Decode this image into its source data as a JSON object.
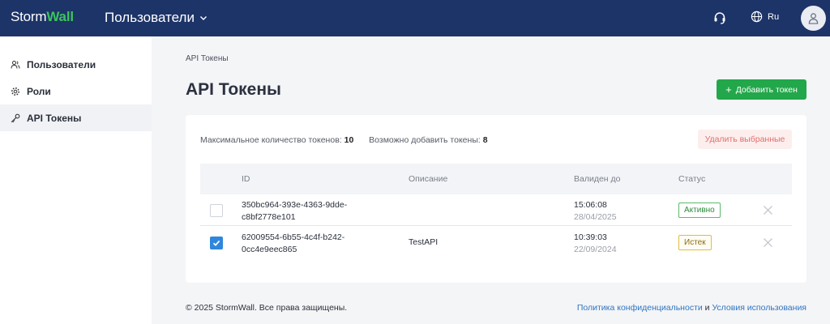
{
  "header": {
    "logo_storm": "Storm",
    "logo_wall": "Wall",
    "section_title": "Пользователи",
    "lang": "Ru",
    "icons": {
      "support": "headset-icon",
      "lang": "globe-icon",
      "avatar": "user-icon"
    }
  },
  "sidebar": {
    "items": [
      {
        "label": "Пользователи",
        "icon": "users-icon",
        "active": false
      },
      {
        "label": "Роли",
        "icon": "gear-icon",
        "active": false
      },
      {
        "label": "API Токены",
        "icon": "key-icon",
        "active": true
      }
    ]
  },
  "main": {
    "breadcrumb": "API Токены",
    "title": "API Токены",
    "add_button": "Добавить токен",
    "stats": {
      "max_label": "Максимальное количество токенов:",
      "max_value": "10",
      "avail_label": "Возможно добавить токены:",
      "avail_value": "8"
    },
    "delete_button": "Удалить выбранные",
    "table": {
      "headers": {
        "id": "ID",
        "desc": "Описание",
        "valid": "Валиден до",
        "status": "Статус"
      },
      "rows": [
        {
          "checked": false,
          "id_line1": "350bc964-393e-4363-9dde-",
          "id_line2": "c8bf2778e101",
          "description": "",
          "time": "15:06:08",
          "date": "28/04/2025",
          "status": "Активно",
          "status_type": "active"
        },
        {
          "checked": true,
          "id_line1": "62009554-6b55-4c4f-b242-",
          "id_line2": "0cc4e9eec865",
          "description": "TestAPI",
          "time": "10:39:03",
          "date": "22/09/2024",
          "status": "Истек",
          "status_type": "expired"
        }
      ]
    }
  },
  "footer": {
    "copyright": "© 2025 StormWall. Все права защищены.",
    "privacy": "Политика конфиденциальности",
    "and": " и ",
    "terms": "Условия использования"
  },
  "colors": {
    "topbar": "#1d3468",
    "brand_green": "#3bc45a",
    "primary_button": "#22a74a",
    "link": "#2f74c0",
    "danger_text": "#e0706b",
    "checkbox": "#2f86dd"
  }
}
